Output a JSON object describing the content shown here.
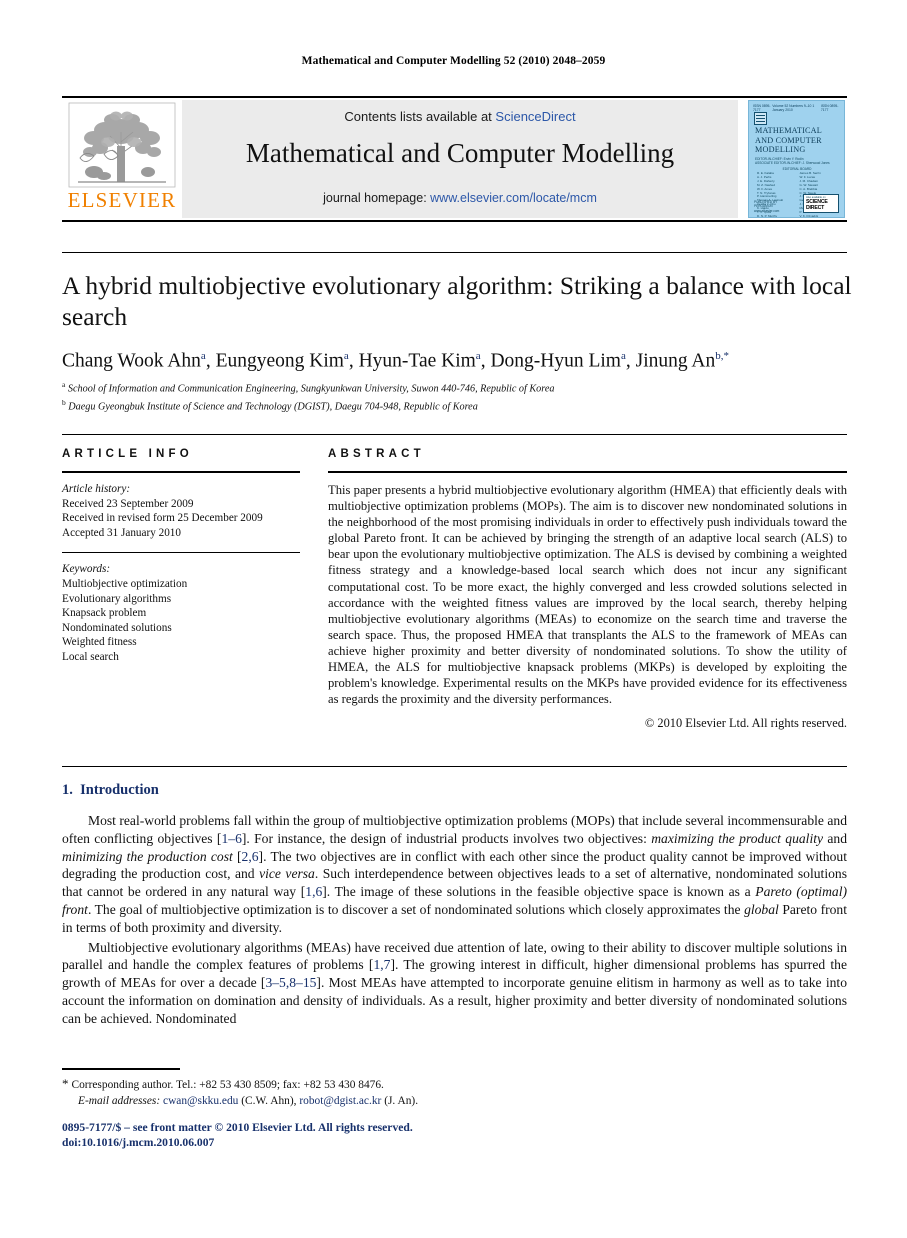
{
  "running_head": "Mathematical and Computer Modelling 52 (2010) 2048–2059",
  "masthead": {
    "publisher_name": "ELSEVIER",
    "contents_prefix": "Contents lists available at ",
    "contents_link": "ScienceDirect",
    "journal_title": "Mathematical and Computer Modelling",
    "homepage_prefix": "journal homepage: ",
    "homepage_url": "www.elsevier.com/locate/mcm",
    "cover": {
      "top_left": "ISSN 0895-7177",
      "top_center": "Volume 52 Numbers 9–10  1 January 2010",
      "top_right": "ISSN 0895-7177",
      "title": "MATHEMATICAL AND COMPUTER MODELLING",
      "editors": "EDITOR-IN-CHIEF: Ervin Y. Rodin\nASSOCIATE EDITOR-IN-CHIEF: J. Sherwood Jones",
      "board_head": "EDITORIAL BOARD",
      "board_left": "R. E. Kalaba\nA. J. Perlis\nJ. E. Flaherty\nM. Z. Nashed\nW. F. Ames\nT. N. Tryfonas\nP. Hammerling\nThomas A. Lasinski\nCecilia Y. Chu\nK. Hajdu\nT. J. Ypma\nD. N. P. Murthy\nB. J. Matkowsky\nJ. C. Simo\nH. W. Broer\nH. E. Koenig",
      "board_right": "James B. Serrin\nW. F. Lucas\nJ. M. Chadam\nG. W. Stewart\nC. A. Brebbia\nC. W. Steele\nJ. D. Murray\nGeorge J. Klir\nJ. R. Rice\nMartin Golubitsky\nP. L. Sachdev\nV. K. Dzyadyk\nR. E. Beckmann\nW. H. Enright\nM. D. Greenberg\nT. D. Gunnarsson",
      "publisher": "PUBLISHED BY\nPERGAMON\nwww.elsevier.com",
      "badge_top": "Also available on",
      "badge_main": "SCIENCE DIRECT"
    }
  },
  "article": {
    "title": "A hybrid multiobjective evolutionary algorithm: Striking a balance with local search",
    "authors": [
      {
        "name": "Chang Wook Ahn",
        "marks": "a"
      },
      {
        "name": "Eungyeong Kim",
        "marks": "a"
      },
      {
        "name": "Hyun-Tae Kim",
        "marks": "a"
      },
      {
        "name": "Dong-Hyun Lim",
        "marks": "a"
      },
      {
        "name": "Jinung An",
        "marks": "b,*"
      }
    ],
    "affiliations": [
      {
        "mark": "a",
        "text": "School of Information and Communication Engineering, Sungkyunkwan University, Suwon 440-746, Republic of Korea"
      },
      {
        "mark": "b",
        "text": "Daegu Gyeongbuk Institute of Science and Technology (DGIST), Daegu 704-948, Republic of Korea"
      }
    ]
  },
  "article_info": {
    "label": "ARTICLE INFO",
    "history_head": "Article history:",
    "history": [
      "Received 23 September 2009",
      "Received in revised form 25 December 2009",
      "Accepted 31 January 2010"
    ],
    "keywords_head": "Keywords:",
    "keywords": [
      "Multiobjective optimization",
      "Evolutionary algorithms",
      "Knapsack problem",
      "Nondominated solutions",
      "Weighted fitness",
      "Local search"
    ]
  },
  "abstract": {
    "label": "ABSTRACT",
    "text": "This paper presents a hybrid multiobjective evolutionary algorithm (HMEA) that efficiently deals with multiobjective optimization problems (MOPs). The aim is to discover new nondominated solutions in the neighborhood of the most promising individuals in order to effectively push individuals toward the global Pareto front. It can be achieved by bringing the strength of an adaptive local search (ALS) to bear upon the evolutionary multiobjective optimization. The ALS is devised by combining a weighted fitness strategy and a knowledge-based local search which does not incur any significant computational cost. To be more exact, the highly converged and less crowded solutions selected in accordance with the weighted fitness values are improved by the local search, thereby helping multiobjective evolutionary algorithms (MEAs) to economize on the search time and traverse the search space. Thus, the proposed HMEA that transplants the ALS to the framework of MEAs can achieve higher proximity and better diversity of nondominated solutions. To show the utility of HMEA, the ALS for multiobjective knapsack problems (MKPs) is developed by exploiting the problem's knowledge. Experimental results on the MKPs have provided evidence for its effectiveness as regards the proximity and the diversity performances.",
    "copyright": "© 2010 Elsevier Ltd. All rights reserved."
  },
  "body": {
    "section_number": "1.",
    "section_title": "Introduction",
    "paragraph1_parts": [
      "Most real-world problems fall within the group of multiobjective optimization problems (MOPs) that include several incommensurable and often conflicting objectives [",
      "1–6",
      "]. For instance, the design of industrial products involves two objectives: ",
      "maximizing the product quality",
      " and ",
      "minimizing the production cost",
      " [",
      "2,6",
      "]. The two objectives are in conflict with each other since the product quality cannot be improved without degrading the production cost, and ",
      "vice versa",
      ". Such interdependence between objectives leads to a set of alternative, nondominated solutions that cannot be ordered in any natural way [",
      "1,6",
      "]. The image of these solutions in the feasible objective space is known as a ",
      "Pareto (optimal) front",
      ". The goal of multiobjective optimization is to discover a set of nondominated solutions which closely approximates the ",
      "global",
      " Pareto front in terms of both proximity and diversity."
    ],
    "paragraph2_parts": [
      "Multiobjective evolutionary algorithms (MEAs) have received due attention of late, owing to their ability to discover multiple solutions in parallel and handle the complex features of problems [",
      "1,7",
      "]. The growing interest in difficult, higher dimensional problems has spurred the growth of MEAs for over a decade [",
      "3–5,8–15",
      "]. Most MEAs have attempted to incorporate genuine elitism in harmony as well as to take into account the information on domination and density of individuals. As a result, higher proximity and better diversity of nondominated solutions can be achieved. Nondominated"
    ]
  },
  "footer": {
    "corresponding_star": "*",
    "corresponding_text": "Corresponding author. Tel.: +82 53 430 8509; fax: +82 53 430 8476.",
    "email_label": "E-mail addresses:",
    "email1": "cwan@skku.edu",
    "email1_owner": "(C.W. Ahn)",
    "email2": "robot@dgist.ac.kr",
    "email2_owner": "(J. An).",
    "imprint_line1": "0895-7177/$ – see front matter © 2010 Elsevier Ltd. All rights reserved.",
    "imprint_doi": "doi:10.1016/j.mcm.2010.06.007"
  }
}
